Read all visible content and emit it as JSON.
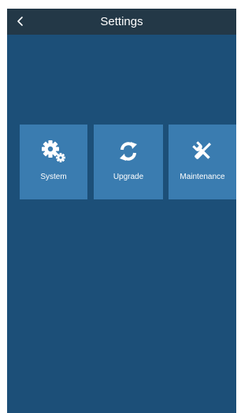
{
  "header": {
    "title": "Settings",
    "back_icon": "chevron-left-icon"
  },
  "colors": {
    "header_bg": "#233847",
    "screen_bg": "#1c4f78",
    "tile_bg": "#3a7cb0",
    "text": "#ffffff"
  },
  "tiles": [
    {
      "label": "System",
      "icon": "gears-icon"
    },
    {
      "label": "Upgrade",
      "icon": "refresh-icon"
    },
    {
      "label": "Maintenance",
      "icon": "tools-icon"
    }
  ]
}
